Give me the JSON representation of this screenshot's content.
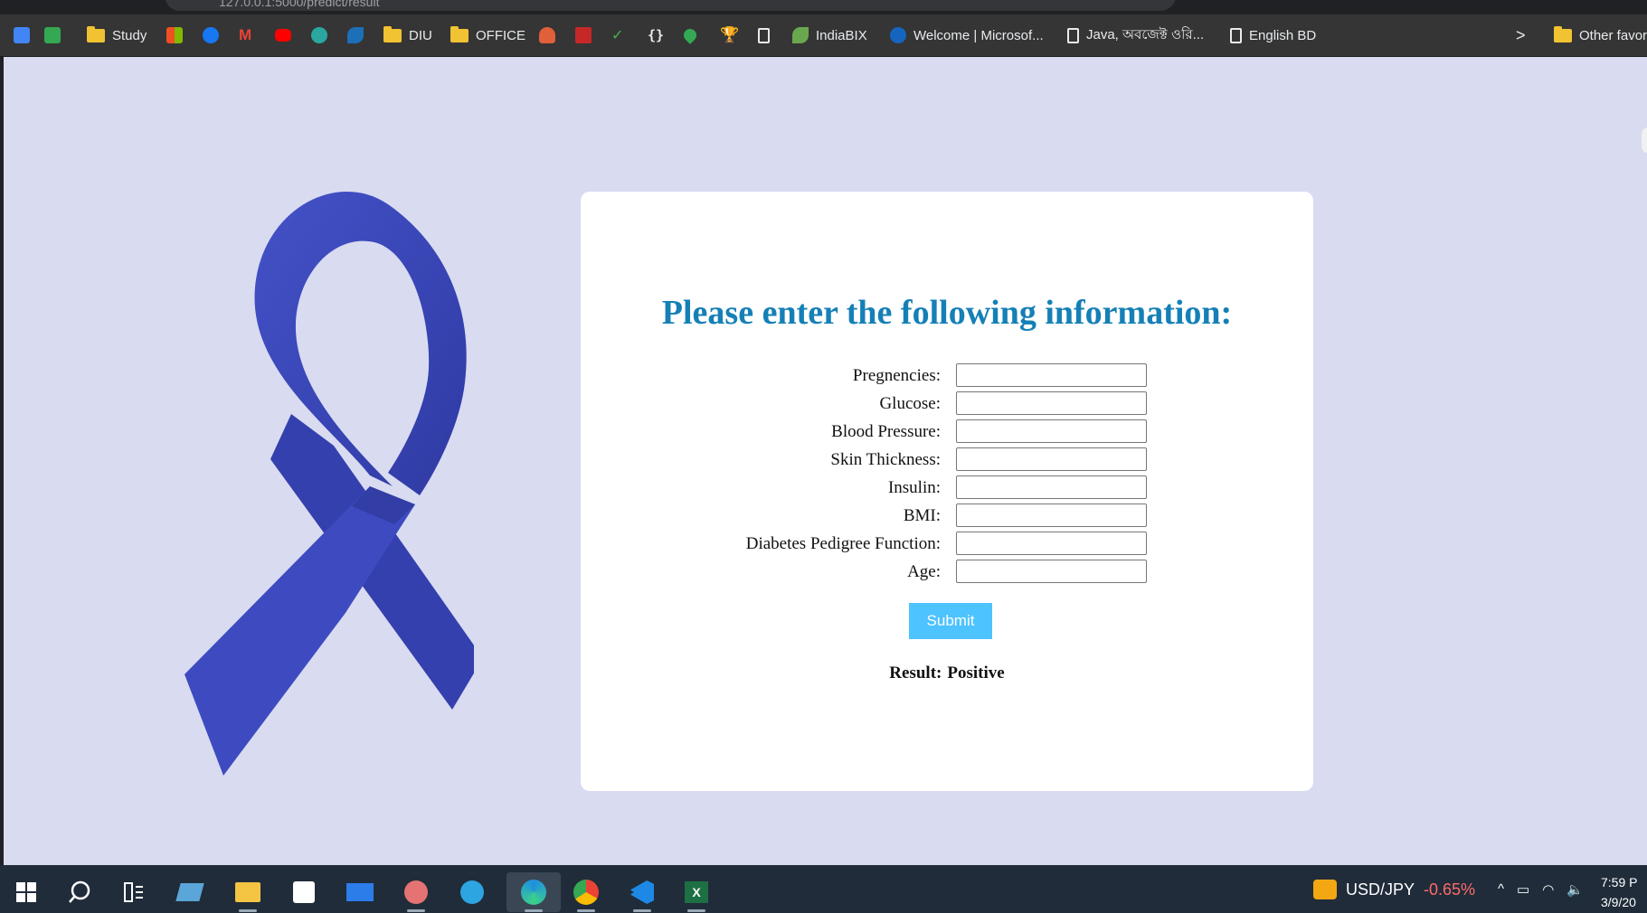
{
  "browser": {
    "url": "127.0.0.1:5000/predict/result"
  },
  "bookmarks": [
    {
      "icon": "google-translate-icon",
      "label": ""
    },
    {
      "icon": "google-photos-icon",
      "label": ""
    },
    {
      "icon": "folder-icon",
      "label": "Study"
    },
    {
      "icon": "microsoft-icon",
      "label": ""
    },
    {
      "icon": "facebook-icon",
      "label": ""
    },
    {
      "icon": "gmail-icon",
      "label": ""
    },
    {
      "icon": "youtube-icon",
      "label": ""
    },
    {
      "icon": "extension-icon",
      "label": ""
    },
    {
      "icon": "edge-bookmark-icon",
      "label": ""
    },
    {
      "icon": "folder-icon",
      "label": "DIU"
    },
    {
      "icon": "folder-icon",
      "label": "OFFICE"
    },
    {
      "icon": "helmet-icon",
      "label": ""
    },
    {
      "icon": "json-pojo-icon",
      "label": ""
    },
    {
      "icon": "check-icon",
      "label": ""
    },
    {
      "icon": "braces-icon",
      "label": ""
    },
    {
      "icon": "maps-icon",
      "label": ""
    },
    {
      "icon": "trophy-icon",
      "label": ""
    },
    {
      "icon": "page-icon",
      "label": ""
    },
    {
      "icon": "indiabix-icon",
      "label": "IndiaBIX"
    },
    {
      "icon": "office-icon",
      "label": "Welcome | Microsof..."
    },
    {
      "icon": "page-icon",
      "label": "Java, অবজেক্ট ওরি..."
    },
    {
      "icon": "page-icon",
      "label": "English BD"
    }
  ],
  "bookmarks_overflow": ">",
  "other_favorites": "Other favori",
  "form": {
    "heading": "Please enter the following information:",
    "fields": [
      {
        "label": "Pregnencies:",
        "value": ""
      },
      {
        "label": "Glucose:",
        "value": ""
      },
      {
        "label": "Blood Pressure:",
        "value": ""
      },
      {
        "label": "Skin Thickness:",
        "value": ""
      },
      {
        "label": "Insulin:",
        "value": ""
      },
      {
        "label": "BMI:",
        "value": ""
      },
      {
        "label": "Diabetes Pedigree Function:",
        "value": ""
      },
      {
        "label": "Age:",
        "value": ""
      }
    ],
    "submit_label": "Submit",
    "result_label": "Result:",
    "result_value": "Positive"
  },
  "taskbar": {
    "apps": [
      "windows-start-icon",
      "search-icon",
      "task-view-icon",
      "notepad-icon",
      "file-explorer-icon",
      "store-icon",
      "mail-icon",
      "snip-icon",
      "telegram-icon",
      "edge-icon",
      "chrome-icon",
      "vscode-icon",
      "excel-icon"
    ],
    "ticker_symbol": "USD/JPY",
    "ticker_change": "-0.65%",
    "time": "7:59 P",
    "date": "3/9/20"
  },
  "colors": {
    "page_background": "#d9dbf1",
    "heading": "#1580b6",
    "submit": "#4dc3ff",
    "ribbon": "#3a45b5"
  }
}
